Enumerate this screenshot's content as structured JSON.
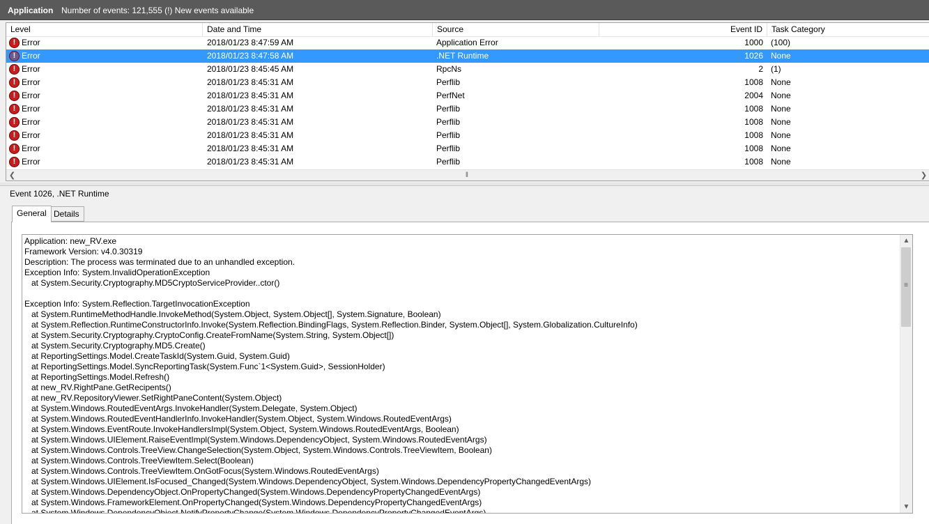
{
  "titlebar": {
    "app": "Application",
    "events": "Number of events: 121,555 (!) New events available"
  },
  "list": {
    "columns": [
      "Level",
      "Date and Time",
      "Source",
      "Event ID",
      "Task Category"
    ],
    "rows": [
      {
        "level": "Error",
        "datetime": "2018/01/23 8:47:59 AM",
        "source": "Application Error",
        "event_id": "1000",
        "category": "(100)",
        "selected": false
      },
      {
        "level": "Error",
        "datetime": "2018/01/23 8:47:58 AM",
        "source": ".NET Runtime",
        "event_id": "1026",
        "category": "None",
        "selected": true
      },
      {
        "level": "Error",
        "datetime": "2018/01/23 8:45:45 AM",
        "source": "RpcNs",
        "event_id": "2",
        "category": "(1)",
        "selected": false
      },
      {
        "level": "Error",
        "datetime": "2018/01/23 8:45:31 AM",
        "source": "Perflib",
        "event_id": "1008",
        "category": "None",
        "selected": false
      },
      {
        "level": "Error",
        "datetime": "2018/01/23 8:45:31 AM",
        "source": "PerfNet",
        "event_id": "2004",
        "category": "None",
        "selected": false
      },
      {
        "level": "Error",
        "datetime": "2018/01/23 8:45:31 AM",
        "source": "Perflib",
        "event_id": "1008",
        "category": "None",
        "selected": false
      },
      {
        "level": "Error",
        "datetime": "2018/01/23 8:45:31 AM",
        "source": "Perflib",
        "event_id": "1008",
        "category": "None",
        "selected": false
      },
      {
        "level": "Error",
        "datetime": "2018/01/23 8:45:31 AM",
        "source": "Perflib",
        "event_id": "1008",
        "category": "None",
        "selected": false
      },
      {
        "level": "Error",
        "datetime": "2018/01/23 8:45:31 AM",
        "source": "Perflib",
        "event_id": "1008",
        "category": "None",
        "selected": false
      },
      {
        "level": "Error",
        "datetime": "2018/01/23 8:45:31 AM",
        "source": "Perflib",
        "event_id": "1008",
        "category": "None",
        "selected": false
      }
    ],
    "icon": "error-icon"
  },
  "detail": {
    "title": "Event 1026, .NET Runtime",
    "tabs": [
      "General",
      "Details"
    ],
    "active_tab": "General",
    "lines": [
      "Application: new_RV.exe",
      "Framework Version: v4.0.30319",
      "Description: The process was terminated due to an unhandled exception.",
      "Exception Info: System.InvalidOperationException",
      "   at System.Security.Cryptography.MD5CryptoServiceProvider..ctor()",
      "",
      "Exception Info: System.Reflection.TargetInvocationException",
      "   at System.RuntimeMethodHandle.InvokeMethod(System.Object, System.Object[], System.Signature, Boolean)",
      "   at System.Reflection.RuntimeConstructorInfo.Invoke(System.Reflection.BindingFlags, System.Reflection.Binder, System.Object[], System.Globalization.CultureInfo)",
      "   at System.Security.Cryptography.CryptoConfig.CreateFromName(System.String, System.Object[])",
      "   at System.Security.Cryptography.MD5.Create()",
      "   at ReportingSettings.Model.CreateTaskId(System.Guid, System.Guid)",
      "   at ReportingSettings.Model.SyncReportingTask(System.Func`1<System.Guid>, SessionHolder)",
      "   at ReportingSettings.Model.Refresh()",
      "   at new_RV.RightPane.GetRecipents()",
      "   at new_RV.RepositoryViewer.SetRightPaneContent(System.Object)",
      "   at System.Windows.RoutedEventArgs.InvokeHandler(System.Delegate, System.Object)",
      "   at System.Windows.RoutedEventHandlerInfo.InvokeHandler(System.Object, System.Windows.RoutedEventArgs)",
      "   at System.Windows.EventRoute.InvokeHandlersImpl(System.Object, System.Windows.RoutedEventArgs, Boolean)",
      "   at System.Windows.UIElement.RaiseEventImpl(System.Windows.DependencyObject, System.Windows.RoutedEventArgs)",
      "   at System.Windows.Controls.TreeView.ChangeSelection(System.Object, System.Windows.Controls.TreeViewItem, Boolean)",
      "   at System.Windows.Controls.TreeViewItem.Select(Boolean)",
      "   at System.Windows.Controls.TreeViewItem.OnGotFocus(System.Windows.RoutedEventArgs)",
      "   at System.Windows.UIElement.IsFocused_Changed(System.Windows.DependencyObject, System.Windows.DependencyPropertyChangedEventArgs)",
      "   at System.Windows.DependencyObject.OnPropertyChanged(System.Windows.DependencyPropertyChangedEventArgs)",
      "   at System.Windows.FrameworkElement.OnPropertyChanged(System.Windows.DependencyPropertyChangedEventArgs)",
      "   at System.Windows.DependencyObject.NotifyPropertyChange(System.Windows.DependencyPropertyChangedEventArgs)"
    ]
  },
  "colors": {
    "titlebar_bg": "#5a5a5a",
    "selection": "#3399ff",
    "error_icon": "#c91c1c"
  }
}
